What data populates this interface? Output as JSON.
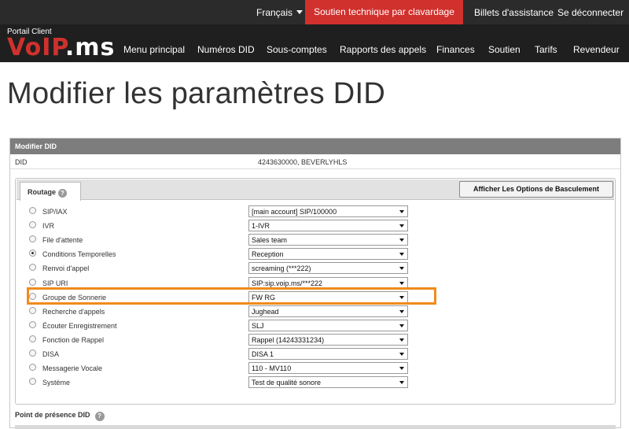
{
  "topbar": {
    "language": "Français",
    "chat_support": "Soutien technique par clavardage",
    "tickets": "Billets d'assistance",
    "logout": "Se déconnecter"
  },
  "brand": {
    "subtitle": "Portail Client",
    "logo": "VoIP.ms"
  },
  "nav": [
    "Menu principal",
    "Numéros DID",
    "Sous-comptes",
    "Rapports des appels",
    "Finances",
    "Soutien",
    "Tarifs",
    "Revendeur"
  ],
  "page_title": "Modifier les paramètres DID",
  "panel": {
    "header": "Modifier DID",
    "did_label": "DID",
    "did_value": "4243630000, BEVERLYHLS"
  },
  "routing": {
    "tab_label": "Routage",
    "help_icon": "?",
    "switch_button": "Afficher Les Options de Basculement",
    "options": [
      {
        "label": "SIP/IAX",
        "value": "[main account] SIP/100000",
        "selected": false
      },
      {
        "label": "IVR",
        "value": "1-IVR",
        "selected": false
      },
      {
        "label": "File d'attente",
        "value": "Sales team",
        "selected": false
      },
      {
        "label": "Conditions Temporelles",
        "value": "Reception",
        "selected": true
      },
      {
        "label": "Renvoi d'appel",
        "value": "screaming (***222)",
        "selected": false
      },
      {
        "label": "SIP URI",
        "value": "SIP:sip.voip.ms/***222",
        "selected": false
      },
      {
        "label": "Groupe de Sonnerie",
        "value": "FW RG",
        "selected": false
      },
      {
        "label": "Recherche d'appels",
        "value": "Jughead",
        "selected": false
      },
      {
        "label": "Écouter Enregistrement",
        "value": "SLJ",
        "selected": false
      },
      {
        "label": "Fonction de Rappel",
        "value": "Rappel (14243331234)",
        "selected": false
      },
      {
        "label": "DISA",
        "value": "DISA 1",
        "selected": false
      },
      {
        "label": "Messagerie Vocale",
        "value": "110 - MV110",
        "selected": false
      },
      {
        "label": "Système",
        "value": "Test de qualité sonore",
        "selected": false
      }
    ]
  },
  "pop": {
    "label": "Point de présence DID",
    "help_icon": "?"
  },
  "colors": {
    "accent_red": "#d0312d",
    "highlight_orange": "#f08b1d"
  }
}
